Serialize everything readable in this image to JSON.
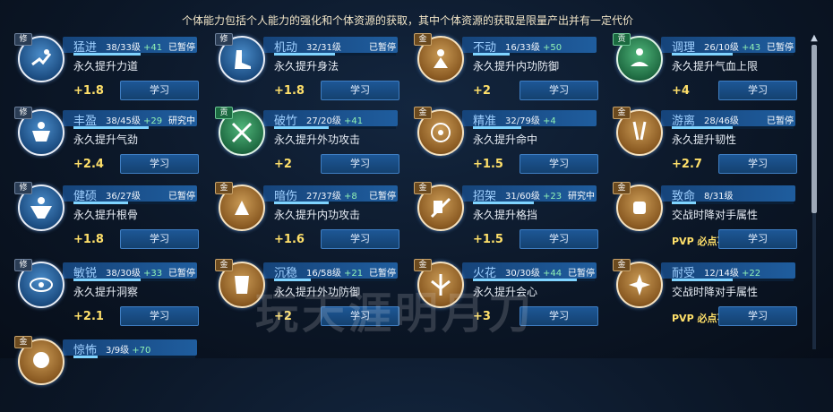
{
  "header": "个体能力包括个人能力的强化和个体资源的获取，其中个体资源的获取是限量产出并有一定代价",
  "learn_label": "学习",
  "watermark": "玩天涯明月刀",
  "cards": [
    {
      "badge": "修",
      "tier": "blue",
      "name": "猛进",
      "level": "38/33级",
      "plus": "+41",
      "status": "已暂停",
      "desc": "永久提升力道",
      "gain": "+1.8",
      "icon": "running-figure-icon",
      "progress": 0.55
    },
    {
      "badge": "修",
      "tier": "blue",
      "name": "机动",
      "level": "32/31级",
      "plus": "",
      "status": "已暂停",
      "desc": "永久提升身法",
      "gain": "+1.8",
      "icon": "boot-icon",
      "progress": 0.5
    },
    {
      "badge": "金",
      "tier": "gold",
      "name": "不动",
      "level": "16/33级",
      "plus": "+50",
      "status": "",
      "desc": "永久提升内功防御",
      "gain": "+2",
      "icon": "shield-figure-icon",
      "progress": 0.3
    },
    {
      "badge": "贡",
      "tier": "green",
      "name": "调理",
      "level": "26/10级",
      "plus": "+43",
      "status": "已暂停",
      "desc": "永久提升气血上限",
      "gain": "+4",
      "icon": "meditation-icon",
      "progress": 0.5
    },
    {
      "badge": "修",
      "tier": "blue",
      "name": "丰盈",
      "level": "38/45级",
      "plus": "+29",
      "status": "研究中",
      "desc": "永久提升气劲",
      "gain": "+2.4",
      "icon": "muscle-icon",
      "progress": 0.62
    },
    {
      "badge": "贡",
      "tier": "green",
      "name": "破竹",
      "level": "27/20级",
      "plus": "+41",
      "status": "",
      "desc": "永久提升外功攻击",
      "gain": "+2",
      "icon": "crossed-swords-icon",
      "progress": 0.45
    },
    {
      "badge": "金",
      "tier": "gold",
      "name": "精准",
      "level": "32/79级",
      "plus": "+4",
      "status": "",
      "desc": "永久提升命中",
      "gain": "+1.5",
      "icon": "target-icon",
      "progress": 0.4
    },
    {
      "badge": "金",
      "tier": "gold",
      "name": "游离",
      "level": "28/46级",
      "plus": "",
      "status": "已暂停",
      "desc": "永久提升韧性",
      "gain": "+2.7",
      "icon": "daggers-icon",
      "progress": 0.5
    },
    {
      "badge": "修",
      "tier": "blue",
      "name": "健硕",
      "level": "36/27级",
      "plus": "",
      "status": "已暂停",
      "desc": "永久提升根骨",
      "gain": "+1.8",
      "icon": "strong-body-icon",
      "progress": 0.45
    },
    {
      "badge": "金",
      "tier": "gold",
      "name": "暗伤",
      "level": "27/37级",
      "plus": "+8",
      "status": "已暂停",
      "desc": "永久提升内功攻击",
      "gain": "+1.6",
      "icon": "hand-strike-icon",
      "progress": 0.45
    },
    {
      "badge": "金",
      "tier": "gold",
      "name": "招架",
      "level": "31/60级",
      "plus": "+23",
      "status": "研究中",
      "desc": "永久提升格挡",
      "gain": "+1.5",
      "icon": "parry-icon",
      "progress": 0.5
    },
    {
      "badge": "金",
      "tier": "gold",
      "name": "致命",
      "level": "8/31级",
      "plus": "",
      "status": "",
      "desc": "交战时降对手属性",
      "gain": "PVP 必点不增加功力",
      "icon": "fist-icon",
      "progress": 0.2
    },
    {
      "badge": "修",
      "tier": "blue",
      "name": "敏锐",
      "level": "38/30级",
      "plus": "+33",
      "status": "已暂停",
      "desc": "永久提升洞察",
      "gain": "+2.1",
      "icon": "eye-icon",
      "progress": 0.55
    },
    {
      "badge": "金",
      "tier": "gold",
      "name": "沉稳",
      "level": "16/58级",
      "plus": "+21",
      "status": "已暂停",
      "desc": "永久提升外功防御",
      "gain": "+2",
      "icon": "armor-icon",
      "progress": 0.3
    },
    {
      "badge": "金",
      "tier": "gold",
      "name": "火花",
      "level": "30/30级",
      "plus": "+44",
      "status": "已暂停",
      "desc": "永久提升会心",
      "gain": "+3",
      "icon": "sparks-icon",
      "progress": 0.85
    },
    {
      "badge": "金",
      "tier": "gold",
      "name": "耐受",
      "level": "12/14级",
      "plus": "+22",
      "status": "",
      "desc": "交战时降对手属性",
      "gain": "PVP 必点不增加功力",
      "icon": "burst-icon",
      "progress": 0.5
    },
    {
      "badge": "金",
      "tier": "gold",
      "name": "惊怖",
      "level": "3/9级",
      "plus": "+70",
      "status": "",
      "desc": "",
      "gain": "",
      "icon": "skull-icon",
      "progress": 0.2
    }
  ]
}
